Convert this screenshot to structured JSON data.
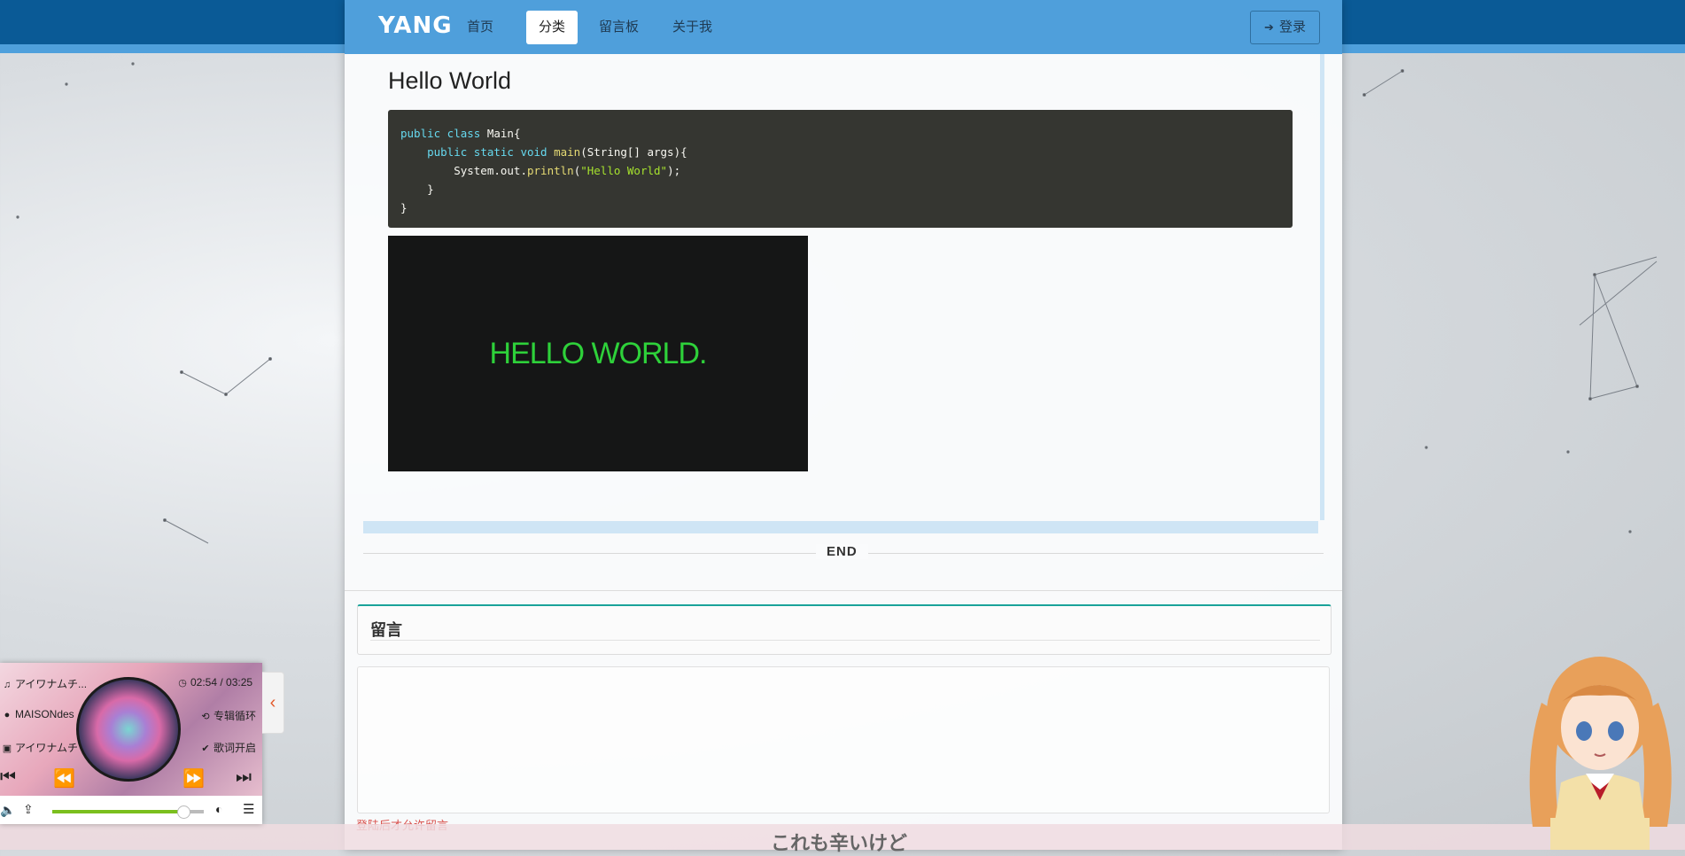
{
  "nav": {
    "brand": "YANG",
    "items": [
      {
        "label": "首页",
        "active": false
      },
      {
        "label": "分类",
        "active": true
      },
      {
        "label": "留言板",
        "active": false
      },
      {
        "label": "关于我",
        "active": false
      }
    ],
    "login_label": "登录",
    "login_icon": "sign-in-icon"
  },
  "post": {
    "title": "Hello World",
    "code_lines": [
      "public class Main{",
      "    public static void main(String[] args){",
      "        System.out.println(\"Hello World\");",
      "    }",
      "}"
    ],
    "image_text": "HELLO WORLD."
  },
  "end_label": "END",
  "comment": {
    "title": "留言",
    "hint": "登陆后才允许留言"
  },
  "player": {
    "song": "アイワナムチ...",
    "artist": "MAISONdes",
    "album": "アイワナムチ",
    "time": "02:54 / 03:25",
    "mode": "专辑循环",
    "lyric_toggle": "歌词开启",
    "progress": 0.865,
    "accent_color": "#7bbf1e"
  },
  "lyric": "これも辛いけど",
  "colors": {
    "navbar": "#4f9fdb",
    "top_band": "#0a5a96",
    "code_bg": "#353631",
    "image_text": "#2ed13a",
    "hint": "#d9534f",
    "comment_accent": "#1aa39a"
  }
}
